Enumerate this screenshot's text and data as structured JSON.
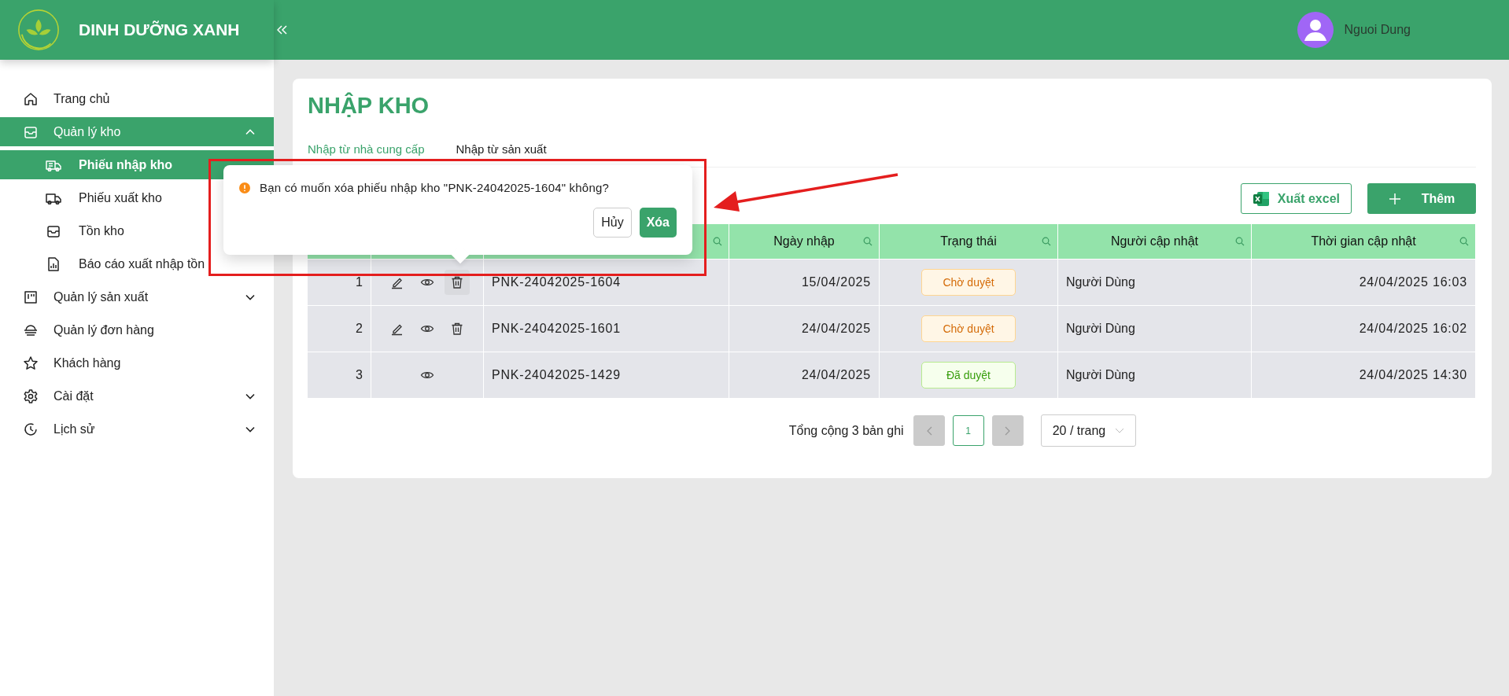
{
  "brand": {
    "name": "DINH DƯỠNG XANH"
  },
  "user": {
    "name": "Nguoi Dung"
  },
  "sidebar": {
    "items": [
      {
        "label": "Trang chủ",
        "selected": false
      },
      {
        "label": "Quản lý kho",
        "selected": true,
        "expanded": true,
        "children": [
          {
            "label": "Phiếu nhập kho",
            "selected": true
          },
          {
            "label": "Phiếu xuất kho",
            "selected": false
          },
          {
            "label": "Tồn kho",
            "selected": false
          },
          {
            "label": "Báo cáo xuất nhập tồn",
            "selected": false
          }
        ]
      },
      {
        "label": "Quản lý sản xuất",
        "selected": false,
        "expanded": false
      },
      {
        "label": "Quản lý đơn hàng",
        "selected": false
      },
      {
        "label": "Khách hàng",
        "selected": false
      },
      {
        "label": "Cài đặt",
        "selected": false,
        "expanded": false
      },
      {
        "label": "Lịch sử",
        "selected": false,
        "expanded": false
      }
    ]
  },
  "page": {
    "title": "NHẬP KHO"
  },
  "tabs": [
    {
      "label": "Nhập từ nhà cung cấp",
      "selected": true
    },
    {
      "label": "Nhập từ sản xuất",
      "selected": false
    }
  ],
  "toolbar": {
    "export_button": "Xuất excel",
    "add_button": "Thêm"
  },
  "table": {
    "columns": [
      "Ngày nhập",
      "Trạng thái",
      "Người cập nhật",
      "Thời gian cập nhật"
    ],
    "rows": [
      {
        "index": "1",
        "actions": [
          {
            "kind": "edit",
            "active": false
          },
          {
            "kind": "view",
            "active": false
          },
          {
            "kind": "delete",
            "active": true
          }
        ],
        "code": "PNK-24042025-1604",
        "date": "15/04/2025",
        "status": {
          "label": "Chờ duyệt",
          "kind": "pending"
        },
        "updated_by": "Người Dùng",
        "updated_at": "24/04/2025 16:03"
      },
      {
        "index": "2",
        "actions": [
          {
            "kind": "edit",
            "active": false
          },
          {
            "kind": "view",
            "active": false
          },
          {
            "kind": "delete",
            "active": false
          }
        ],
        "code": "PNK-24042025-1601",
        "date": "24/04/2025",
        "status": {
          "label": "Chờ duyệt",
          "kind": "pending"
        },
        "updated_by": "Người Dùng",
        "updated_at": "24/04/2025 16:02"
      },
      {
        "index": "3",
        "actions": [
          {
            "kind": "view",
            "active": false
          }
        ],
        "code": "PNK-24042025-1429",
        "date": "24/04/2025",
        "status": {
          "label": "Đã duyệt",
          "kind": "approved"
        },
        "updated_by": "Người Dùng",
        "updated_at": "24/04/2025 14:30"
      }
    ]
  },
  "pagination": {
    "total": "Tổng cộng 3 bản ghi",
    "prev_disabled": true,
    "next_disabled": true,
    "pages": [
      {
        "label": "1",
        "selected": true
      }
    ],
    "page_size": "20 / trang"
  },
  "confirm_popup": {
    "message": "Bạn có muốn xóa phiếu nhập kho \"PNK-24042025-1604\" không?",
    "cancel": "Hủy",
    "confirm": "Xóa"
  }
}
